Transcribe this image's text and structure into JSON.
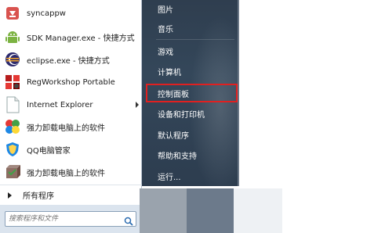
{
  "programs": [
    {
      "label": "syncappw",
      "icon": "syncappw-icon",
      "has_arrow": false
    },
    {
      "label": "SDK Manager.exe - 快捷方式",
      "icon": "android-icon",
      "has_arrow": false
    },
    {
      "label": "eclipse.exe - 快捷方式",
      "icon": "eclipse-icon",
      "has_arrow": false
    },
    {
      "label": "RegWorkshop Portable",
      "icon": "regworkshop-icon",
      "has_arrow": false
    },
    {
      "label": "Internet Explorer",
      "icon": "internet-explorer-icon",
      "has_arrow": true
    },
    {
      "label": "强力卸载电脑上的软件",
      "icon": "uninstall-icon",
      "has_arrow": false
    },
    {
      "label": "QQ电脑管家",
      "icon": "qq-guard-icon",
      "has_arrow": false
    },
    {
      "label": "强力卸载电脑上的软件",
      "icon": "uninstall-box-icon",
      "has_arrow": false
    }
  ],
  "all_programs": "所有程序",
  "search": {
    "placeholder": "搜索程序和文件"
  },
  "right_items": [
    "图片",
    "音乐",
    "游戏",
    "计算机",
    "控制面板",
    "设备和打印机",
    "默认程序",
    "帮助和支持",
    "运行..."
  ],
  "highlighted_item": "控制面板",
  "colors": {
    "highlight_border": "#e02020",
    "right_pane": "#34475a",
    "search_bar": "#dbe4ee"
  }
}
